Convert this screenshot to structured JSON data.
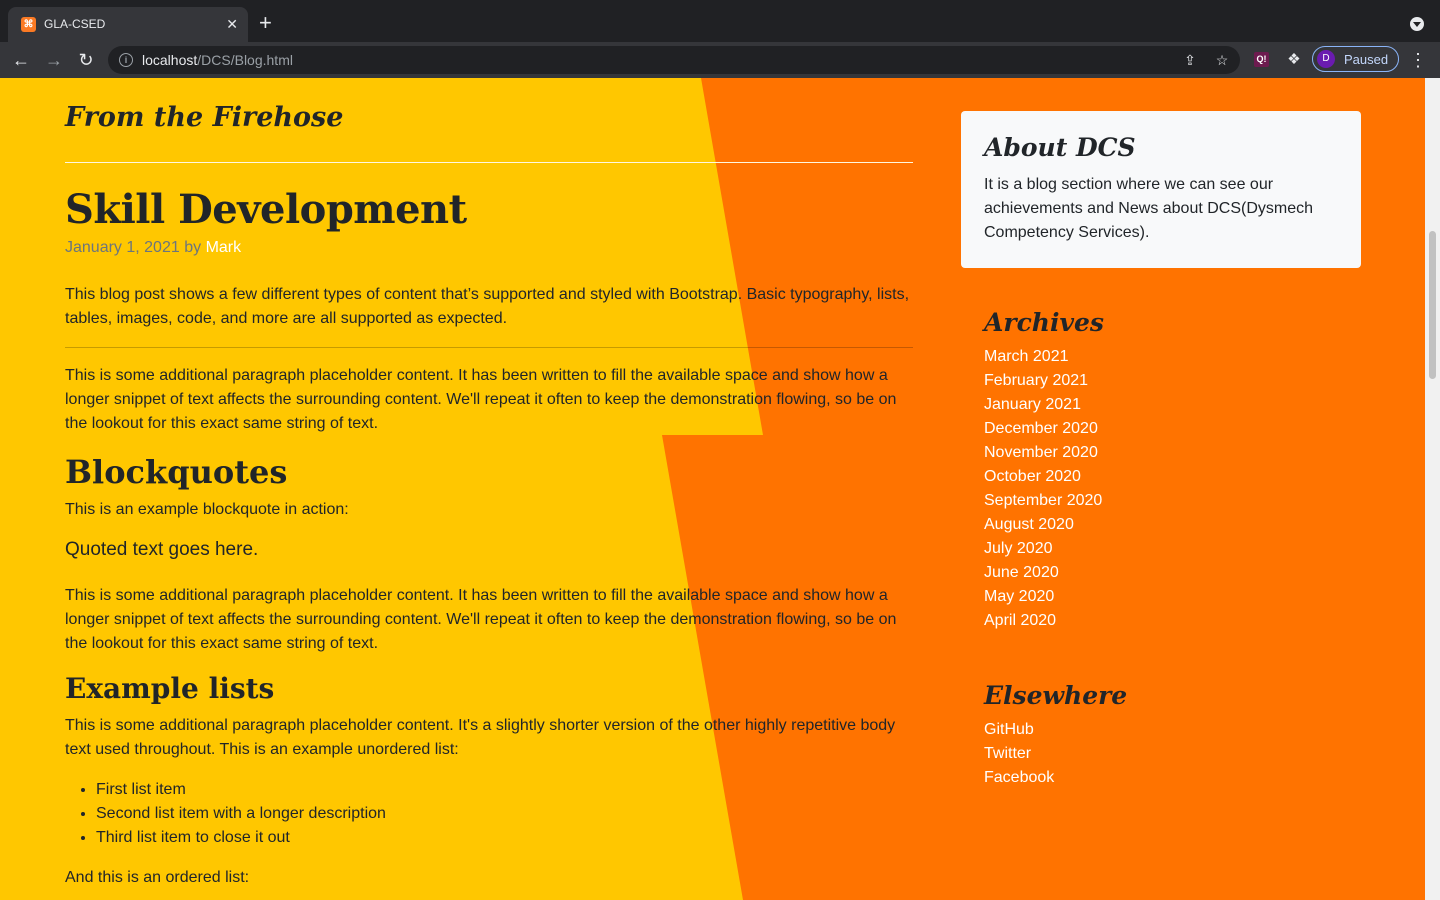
{
  "browser": {
    "tab_title": "GLA-CSED",
    "tab_favicon": "xampp-icon",
    "url_host": "localhost",
    "url_path": "/DCS/Blog.html",
    "profile_initial": "D",
    "profile_status": "Paused",
    "extension_label": "Q!"
  },
  "page": {
    "section_title": "From the Firehose",
    "post": {
      "title": "Skill Development",
      "date": "January 1, 2021",
      "by": "by",
      "author": "Mark",
      "intro": "This blog post shows a few different types of content that’s supported and styled with Bootstrap. Basic typography, lists, tables, images, code, and more are all supported as expected.",
      "paragraph1": "This is some additional paragraph placeholder content. It has been written to fill the available space and show how a longer snippet of text affects the surrounding content. We'll repeat it often to keep the demonstration flowing, so be on the lookout for this exact same string of text.",
      "blockquotes_heading": "Blockquotes",
      "blockquote_intro": "This is an example blockquote in action:",
      "quote": "Quoted text goes here.",
      "paragraph2": "This is some additional paragraph placeholder content. It has been written to fill the available space and show how a longer snippet of text affects the surrounding content. We'll repeat it often to keep the demonstration flowing, so be on the lookout for this exact same string of text.",
      "lists_heading": "Example lists",
      "lists_intro": "This is some additional paragraph placeholder content. It's a slightly shorter version of the other highly repetitive body text used throughout. This is an example unordered list:",
      "unordered_list": [
        "First list item",
        "Second list item with a longer description",
        "Third list item to close it out"
      ],
      "ordered_intro": "And this is an ordered list:"
    }
  },
  "sidebar": {
    "about_title": "About DCS",
    "about_text": "It is a blog section where we can see our achievements and News about DCS(Dysmech Competency Services).",
    "archives_title": "Archives",
    "archives": [
      "March 2021",
      "February 2021",
      "January 2021",
      "December 2020",
      "November 2020",
      "October 2020",
      "September 2020",
      "August 2020",
      "July 2020",
      "June 2020",
      "May 2020",
      "April 2020"
    ],
    "elsewhere_title": "Elsewhere",
    "elsewhere": [
      "GitHub",
      "Twitter",
      "Facebook"
    ]
  },
  "colors": {
    "yellow": "#ffc700",
    "orange": "#ff7300",
    "card": "#f8f9fa",
    "text": "#212529",
    "muted": "#6c757d"
  }
}
